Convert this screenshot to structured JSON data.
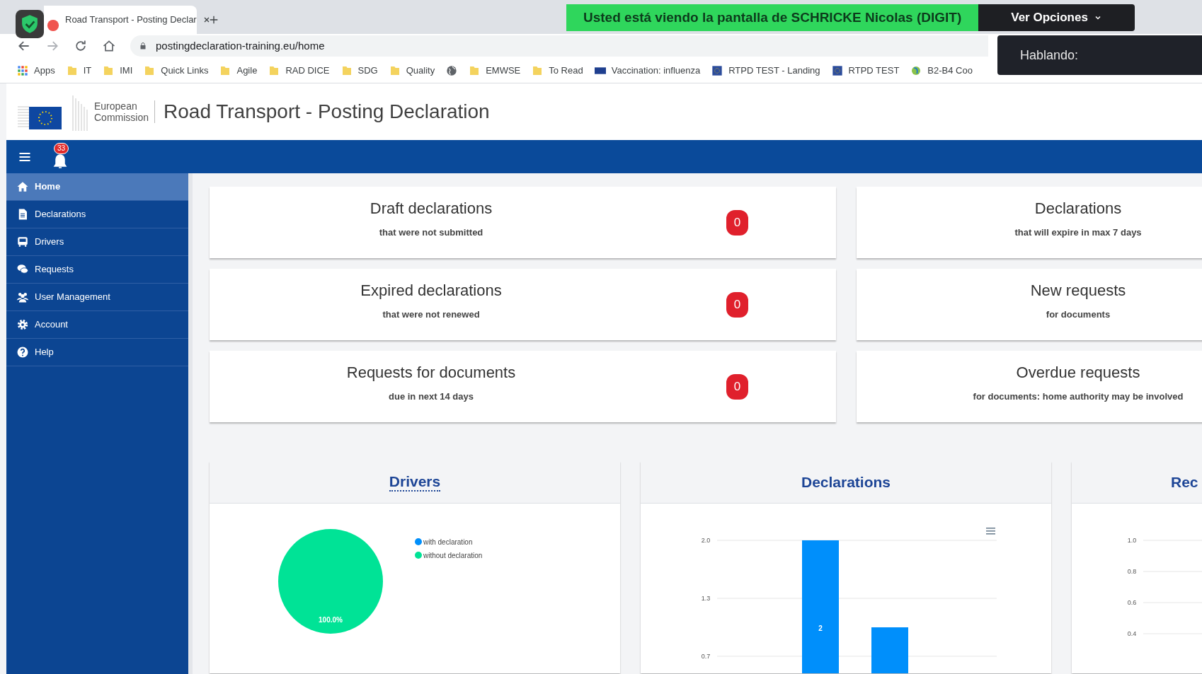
{
  "browser": {
    "tab_title": "Road Transport - Posting Declar",
    "url": "postingdeclaration-training.eu/home",
    "bookmarks": [
      {
        "label": "Apps",
        "kind": "apps"
      },
      {
        "label": "IT",
        "kind": "folder"
      },
      {
        "label": "IMI",
        "kind": "folder"
      },
      {
        "label": "Quick Links",
        "kind": "folder"
      },
      {
        "label": "Agile",
        "kind": "folder"
      },
      {
        "label": "RAD DICE",
        "kind": "folder"
      },
      {
        "label": "SDG",
        "kind": "folder"
      },
      {
        "label": "Quality",
        "kind": "folder"
      },
      {
        "kind": "globe"
      },
      {
        "label": "EMWSE",
        "kind": "folder"
      },
      {
        "label": "To Read",
        "kind": "folder"
      },
      {
        "label": "Vaccination: influenza",
        "kind": "flag"
      },
      {
        "label": "RTPD TEST - Landing",
        "kind": "eu"
      },
      {
        "label": "RTPD TEST",
        "kind": "eu"
      },
      {
        "label": "B2-B4 Coo",
        "kind": "leaf"
      }
    ]
  },
  "zoom_overlay": {
    "banner": "Usted está viendo la pantalla de SCHRICKE Nicolas (DIGIT)",
    "options_button": "Ver Opciones",
    "speaking_label": "Hablando:"
  },
  "header": {
    "logo_line1": "European",
    "logo_line2": "Commission",
    "title": "Road Transport - Posting Declaration"
  },
  "navbar": {
    "notification_count": "33"
  },
  "sidebar": {
    "items": [
      {
        "label": "Home",
        "kind": "home",
        "selected": true
      },
      {
        "label": "Declarations",
        "kind": "file",
        "selected": false
      },
      {
        "label": "Drivers",
        "kind": "bus",
        "selected": false
      },
      {
        "label": "Requests",
        "kind": "chat",
        "selected": false
      },
      {
        "label": "User Management",
        "kind": "users",
        "selected": false
      },
      {
        "label": "Account",
        "kind": "gear",
        "selected": false
      },
      {
        "label": "Help",
        "kind": "help",
        "selected": false
      }
    ]
  },
  "stat_cards": [
    {
      "title": "Draft declarations",
      "subtitle": "that were not submitted",
      "count": "0"
    },
    {
      "title": "Declarations",
      "subtitle": "that will expire in max 7 days"
    },
    {
      "title": "Expired declarations",
      "subtitle": "that were not renewed",
      "count": "0"
    },
    {
      "title": "New requests",
      "subtitle": "for documents"
    },
    {
      "title": "Requests for documents",
      "subtitle": "due in next 14 days",
      "count": "0"
    },
    {
      "title": "Overdue requests",
      "subtitle": "for documents: home authority may be involved"
    }
  ],
  "charts": [
    {
      "title": "Drivers",
      "underlined": true,
      "chart_data": {
        "type": "pie",
        "categories": [
          "with declaration",
          "without declaration"
        ],
        "values": [
          0,
          100
        ],
        "value_labels": [
          null,
          "100.0%"
        ]
      }
    },
    {
      "title": "Declarations",
      "underlined": false,
      "chart_data": {
        "type": "bar",
        "categories": [
          null,
          null
        ],
        "values": [
          2,
          1
        ],
        "ylim": [
          0,
          2
        ],
        "yticks": [
          {
            "value": 2,
            "label": "2.0"
          },
          {
            "value": 1.333,
            "label": "1.3"
          },
          {
            "value": 0.667,
            "label": "0.7"
          }
        ],
        "value_labels": [
          "2",
          null
        ]
      }
    },
    {
      "title": "Rec",
      "underlined": false,
      "axis_labels": [
        "1.0",
        "0.8",
        "0.6",
        "0.4"
      ]
    }
  ]
}
